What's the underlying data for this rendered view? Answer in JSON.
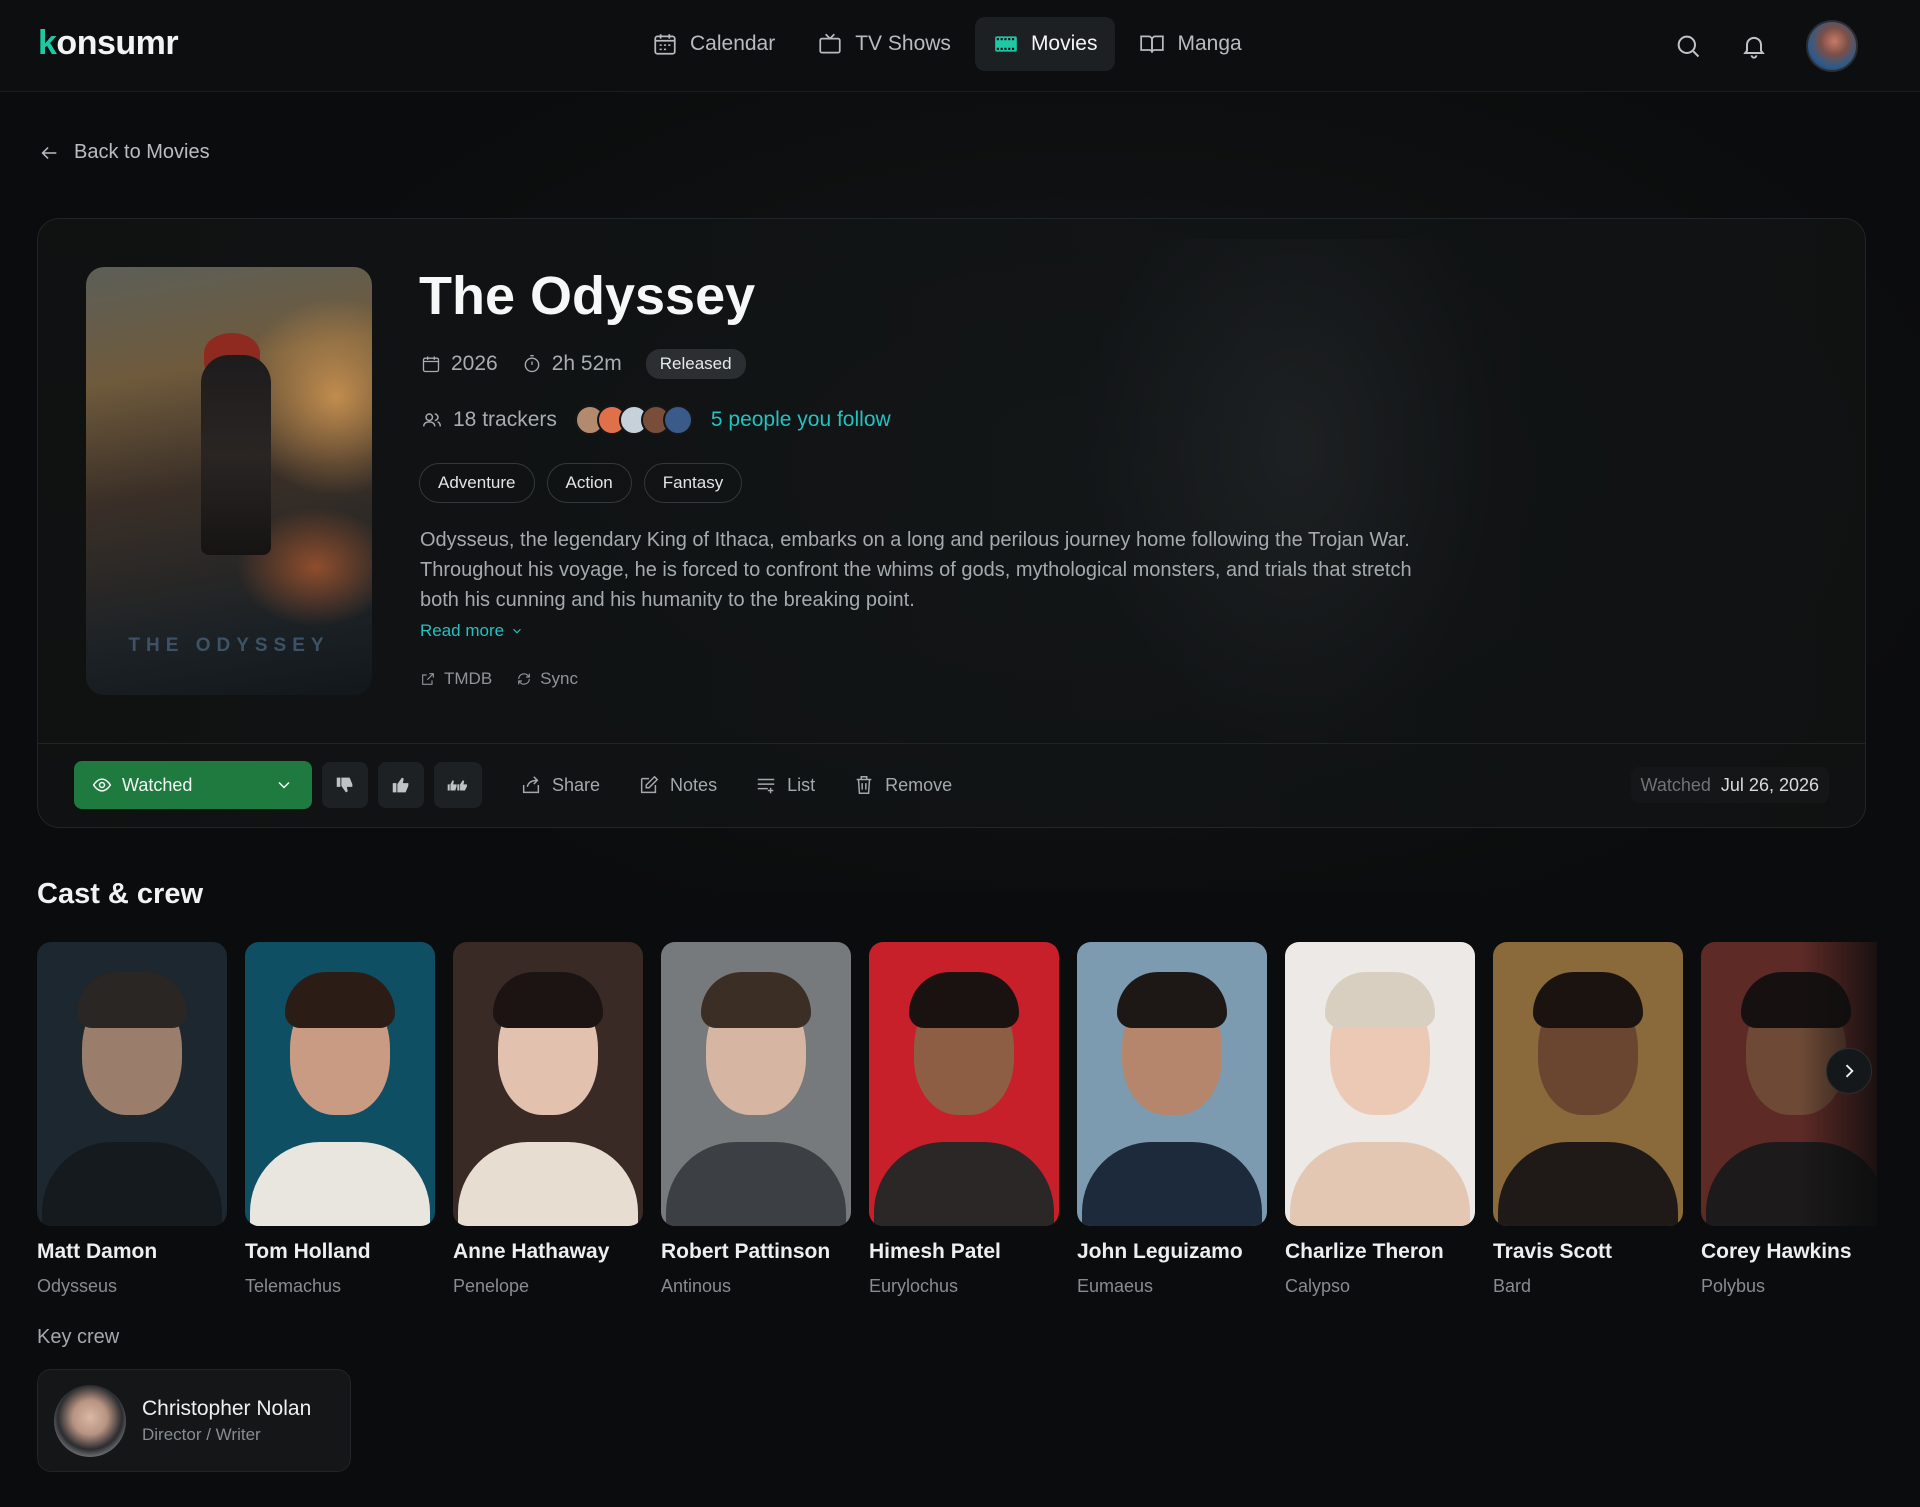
{
  "app": {
    "logo_first": "k",
    "logo_rest": "onsumr"
  },
  "nav": [
    {
      "label": "Calendar",
      "icon": "calendar-icon",
      "active": false
    },
    {
      "label": "TV Shows",
      "icon": "tv-icon",
      "active": false
    },
    {
      "label": "Movies",
      "icon": "film-icon",
      "active": true
    },
    {
      "label": "Manga",
      "icon": "book-icon",
      "active": false
    }
  ],
  "back": {
    "label": "Back to Movies"
  },
  "movie": {
    "title": "The Odyssey",
    "poster_caption": "THE ODYSSEY",
    "year": "2026",
    "runtime": "2h 52m",
    "status": "Released",
    "trackers": "18 trackers",
    "follow_text": "5 people you follow",
    "genres": [
      "Adventure",
      "Action",
      "Fantasy"
    ],
    "overview": "Odysseus, the legendary King of Ithaca, embarks on a long and perilous journey home following the Trojan War. Throughout his voyage, he is forced to confront the whims of gods, mythological monsters, and trials that stretch both his cunning and his humanity to the breaking point.",
    "read_more": "Read more",
    "links": {
      "tmdb": "TMDB",
      "sync": "Sync"
    }
  },
  "actions": {
    "status_label": "Watched",
    "share": "Share",
    "notes": "Notes",
    "list": "List",
    "remove": "Remove",
    "watched_label": "Watched",
    "watched_date": "Jul 26, 2026"
  },
  "cast_section": {
    "title": "Cast & crew"
  },
  "cast": [
    {
      "name": "Matt Damon",
      "role": "Odysseus",
      "bg": "#1c2730",
      "skin": "#9b7d6c",
      "hair": "#2a2623",
      "clothes": "#151a1f"
    },
    {
      "name": "Tom Holland",
      "role": "Telemachus",
      "bg": "#0f4f63",
      "skin": "#c89b82",
      "hair": "#2b1d16",
      "clothes": "#e9e6df"
    },
    {
      "name": "Anne Hathaway",
      "role": "Penelope",
      "bg": "#3a2a26",
      "skin": "#e2c2ae",
      "hair": "#1b1413",
      "clothes": "#e7ddd1"
    },
    {
      "name": "Robert Pattinson",
      "role": "Antinous",
      "bg": "#777a7c",
      "skin": "#d6b6a3",
      "hair": "#3b2e25",
      "clothes": "#3c4044"
    },
    {
      "name": "Himesh Patel",
      "role": "Eurylochus",
      "bg": "#c8202b",
      "skin": "#8e5e44",
      "hair": "#1a1210",
      "clothes": "#2a2726"
    },
    {
      "name": "John Leguizamo",
      "role": "Eumaeus",
      "bg": "#7d9bb0",
      "skin": "#b5866b",
      "hair": "#1d1815",
      "clothes": "#1c2a3b"
    },
    {
      "name": "Charlize Theron",
      "role": "Calypso",
      "bg": "#ece9e6",
      "skin": "#ecc9b5",
      "hair": "#d8cfc0",
      "clothes": "#e3c7b3"
    },
    {
      "name": "Travis Scott",
      "role": "Bard",
      "bg": "#8a6a3a",
      "skin": "#6a4630",
      "hair": "#1a1310",
      "clothes": "#1f1a17"
    },
    {
      "name": "Corey Hawkins",
      "role": "Polybus",
      "bg": "#5e2a26",
      "skin": "#6e4a36",
      "hair": "#161110",
      "clothes": "#1c1a1a"
    }
  ],
  "key_crew": {
    "label": "Key crew",
    "people": [
      {
        "name": "Christopher Nolan",
        "role": "Director / Writer"
      }
    ]
  }
}
